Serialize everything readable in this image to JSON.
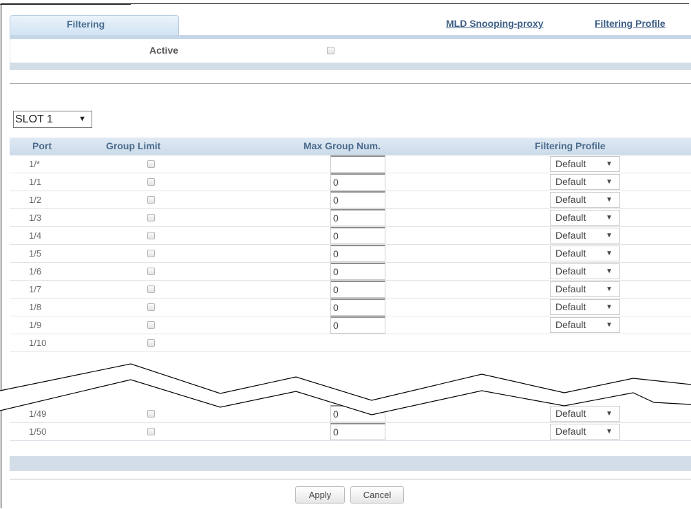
{
  "tabs": {
    "active": "Filtering",
    "links": [
      "MLD Snooping-proxy",
      "Filtering Profile"
    ]
  },
  "active_label": "Active",
  "slot": "SLOT 1",
  "columns": [
    "Port",
    "Group Limit",
    "Max Group Num.",
    "Filtering Profile"
  ],
  "rows": [
    {
      "port": "1/*",
      "max": "",
      "profile": "Default"
    },
    {
      "port": "1/1",
      "max": "0",
      "profile": "Default"
    },
    {
      "port": "1/2",
      "max": "0",
      "profile": "Default"
    },
    {
      "port": "1/3",
      "max": "0",
      "profile": "Default"
    },
    {
      "port": "1/4",
      "max": "0",
      "profile": "Default"
    },
    {
      "port": "1/5",
      "max": "0",
      "profile": "Default"
    },
    {
      "port": "1/6",
      "max": "0",
      "profile": "Default"
    },
    {
      "port": "1/7",
      "max": "0",
      "profile": "Default"
    },
    {
      "port": "1/8",
      "max": "0",
      "profile": "Default"
    },
    {
      "port": "1/9",
      "max": "0",
      "profile": "Default"
    },
    {
      "port": "1/10",
      "max": "",
      "profile": ""
    },
    {
      "port": "1/49",
      "max": "0",
      "profile": "Default"
    },
    {
      "port": "1/50",
      "max": "0",
      "profile": "Default"
    }
  ],
  "buttons": {
    "apply": "Apply",
    "cancel": "Cancel"
  }
}
